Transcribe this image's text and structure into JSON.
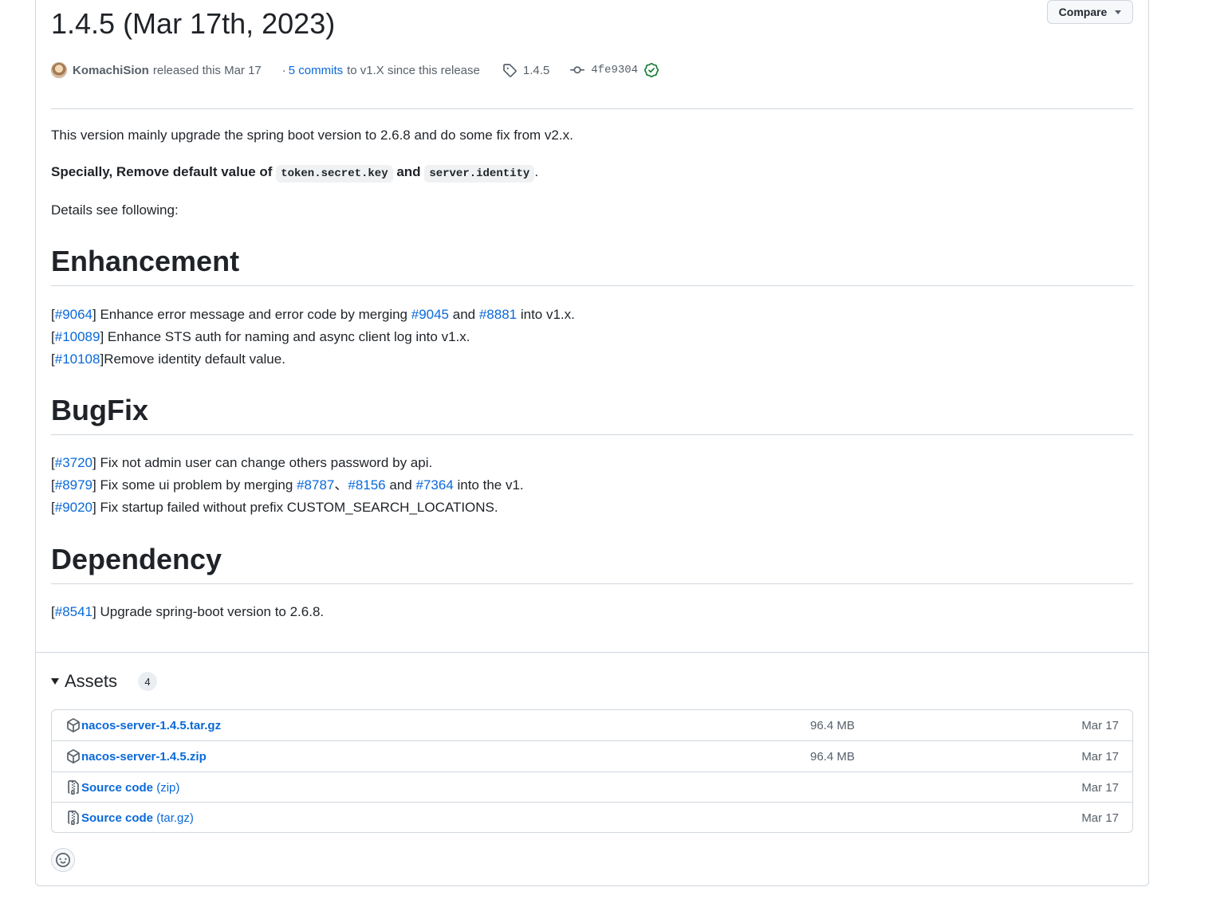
{
  "release": {
    "title": "1.4.5 (Mar 17th, 2023)",
    "compare_label": "Compare",
    "author": "KomachiSion",
    "released_text": "released this Mar 17",
    "dot": "·",
    "commits_link": "5 commits",
    "commits_suffix": "to v1.X since this release",
    "tag": "1.4.5",
    "commit_sha": "4fe9304"
  },
  "body": {
    "intro": "This version mainly upgrade the spring boot version to 2.6.8 and do some fix from v2.x.",
    "specially_prefix": "Specially, Remove default value of",
    "code1": "token.secret.key",
    "and_word": "and",
    "code2": "server.identity",
    "period": ".",
    "details": "Details see following:"
  },
  "sections": {
    "enhancement": {
      "heading": "Enhancement",
      "items": [
        {
          "open": "[",
          "id": "#9064",
          "close": "]",
          "text": " Enhance error message and error code by merging ",
          "link2": "#9045",
          "mid": " and ",
          "link3": "#8881",
          "tail": " into v1.x."
        },
        {
          "open": "[",
          "id": "#10089",
          "close": "]",
          "text": " Enhance STS auth for naming and async client log into v1.x."
        },
        {
          "open": "[",
          "id": "#10108",
          "close": "]",
          "text": "Remove identity default value."
        }
      ]
    },
    "bugfix": {
      "heading": "BugFix",
      "items": [
        {
          "open": "[",
          "id": "#3720",
          "close": "]",
          "text": " Fix not admin user can change others password by api."
        },
        {
          "open": "[",
          "id": "#8979",
          "close": "]",
          "text": " Fix some ui problem by merging ",
          "link2": "#8787",
          "sep": "、",
          "link3": "#8156",
          "mid": " and ",
          "link4": "#7364",
          "tail": " into the v1."
        },
        {
          "open": "[",
          "id": "#9020",
          "close": "]",
          "text": " Fix startup failed without prefix CUSTOM_SEARCH_LOCATIONS."
        }
      ]
    },
    "dependency": {
      "heading": "Dependency",
      "items": [
        {
          "open": "[",
          "id": "#8541",
          "close": "]",
          "text": " Upgrade spring-boot version to 2.6.8."
        }
      ]
    }
  },
  "assets": {
    "heading": "Assets",
    "count": "4",
    "rows": [
      {
        "name": "nacos-server-1.4.5.tar.gz",
        "ext": "",
        "size": "96.4 MB",
        "date": "Mar 17",
        "icon": "package-icon"
      },
      {
        "name": "nacos-server-1.4.5.zip",
        "ext": "",
        "size": "96.4 MB",
        "date": "Mar 17",
        "icon": "package-icon"
      },
      {
        "name": "Source code",
        "ext": "(zip)",
        "size": "",
        "date": "Mar 17",
        "icon": "file-zip-icon"
      },
      {
        "name": "Source code",
        "ext": "(tar.gz)",
        "size": "",
        "date": "Mar 17",
        "icon": "file-zip-icon"
      }
    ]
  },
  "colors": {
    "link": "#0969da",
    "text": "#1f2328",
    "muted": "#57606a",
    "border": "#d0d7de",
    "verified": "#1a7f37"
  }
}
